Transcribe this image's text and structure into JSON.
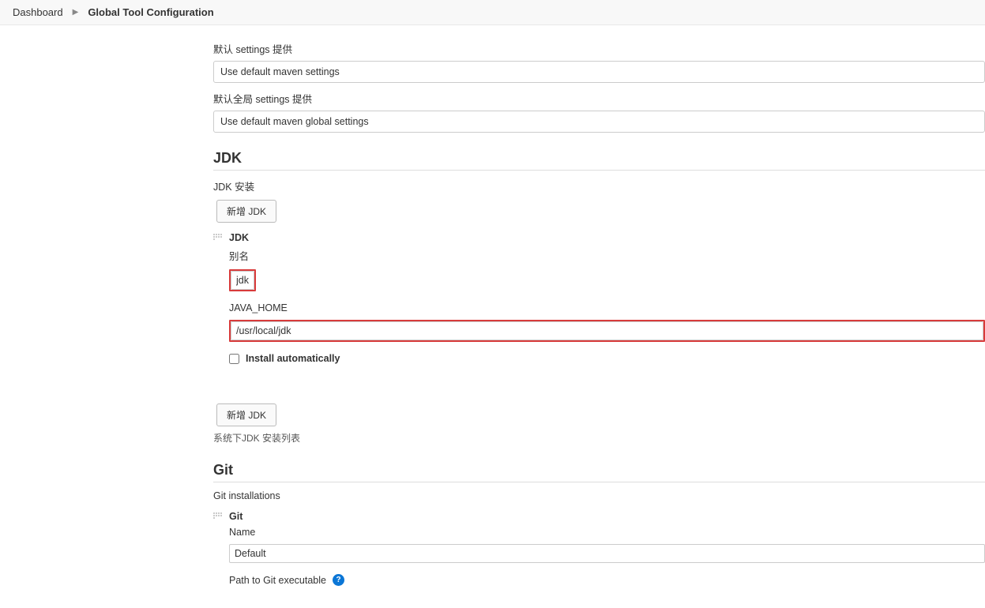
{
  "breadcrumb": {
    "root": "Dashboard",
    "current": "Global Tool Configuration"
  },
  "maven_settings": {
    "default_label": "默认 settings 提供",
    "default_value": "Use default maven settings",
    "global_label": "默认全局 settings 提供",
    "global_value": "Use default maven global settings"
  },
  "jdk": {
    "heading": "JDK",
    "install_label": "JDK 安装",
    "add_button": "新增 JDK",
    "entry_title": "JDK",
    "alias_label": "别名",
    "alias_value": "jdk",
    "java_home_label": "JAVA_HOME",
    "java_home_value": "/usr/local/jdk",
    "install_auto_label": "Install automatically",
    "install_auto_checked": false,
    "add_button2": "新增 JDK",
    "list_hint": "系统下JDK 安装列表"
  },
  "git": {
    "heading": "Git",
    "installations_label": "Git installations",
    "entry_title": "Git",
    "name_label": "Name",
    "name_value": "Default",
    "path_label": "Path to Git executable"
  }
}
